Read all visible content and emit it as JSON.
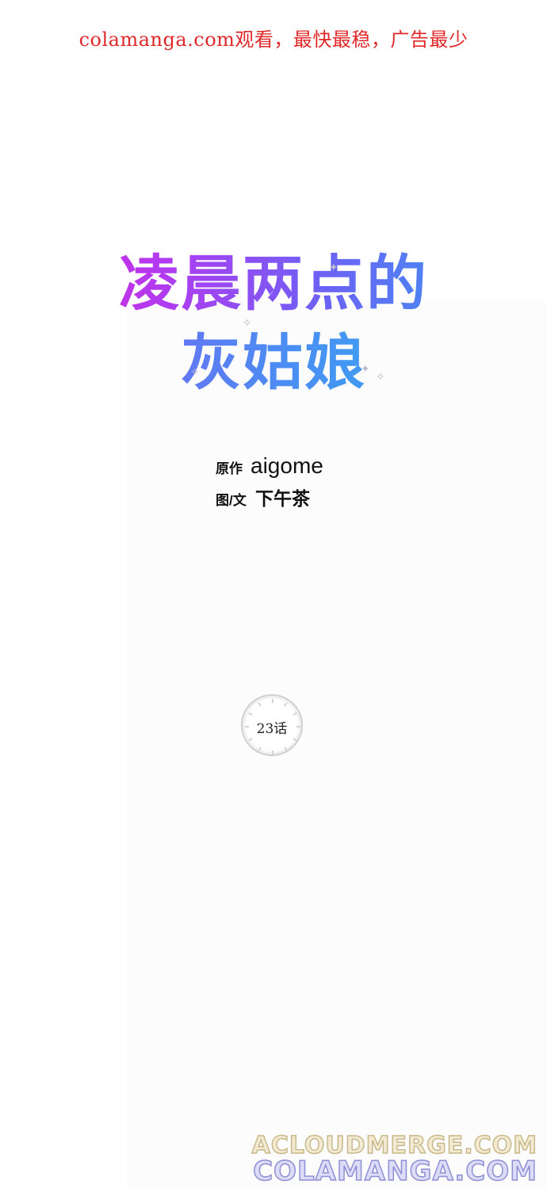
{
  "banner": {
    "text": "colamanga.com观看，最快最稳，广告最少",
    "color": "#e0282a"
  },
  "title": {
    "line1": "凌晨两点的",
    "line2": "灰姑娘",
    "gradient_start": "#e61fd9",
    "gradient_end": "#27b7ee"
  },
  "credits": {
    "original_label": "原作",
    "original_value": "aigome",
    "art_label": "图/文",
    "art_value": "下午茶"
  },
  "chapter": {
    "label": "23话"
  },
  "watermarks": {
    "line1": "ACLOUDMERGE.COM",
    "line2": "COLAMANGA.COM"
  }
}
